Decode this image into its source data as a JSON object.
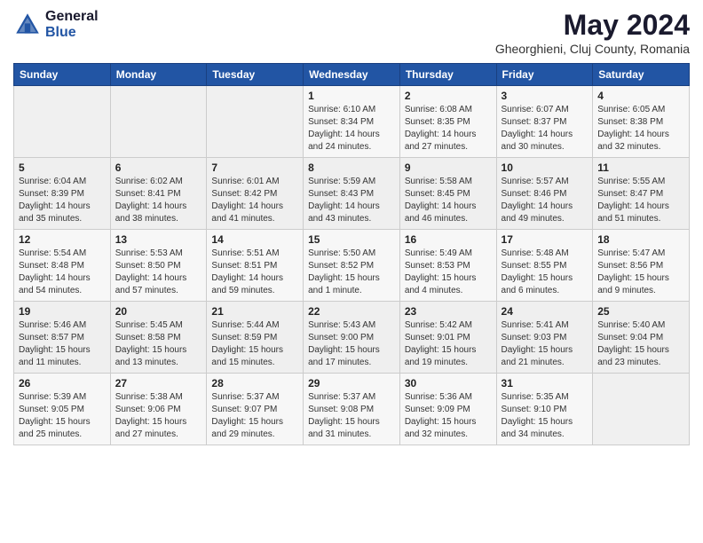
{
  "header": {
    "logo_general": "General",
    "logo_blue": "Blue",
    "month_year": "May 2024",
    "location": "Gheorghieni, Cluj County, Romania"
  },
  "weekdays": [
    "Sunday",
    "Monday",
    "Tuesday",
    "Wednesday",
    "Thursday",
    "Friday",
    "Saturday"
  ],
  "weeks": [
    [
      {
        "day": "",
        "info": ""
      },
      {
        "day": "",
        "info": ""
      },
      {
        "day": "",
        "info": ""
      },
      {
        "day": "1",
        "info": "Sunrise: 6:10 AM\nSunset: 8:34 PM\nDaylight: 14 hours\nand 24 minutes."
      },
      {
        "day": "2",
        "info": "Sunrise: 6:08 AM\nSunset: 8:35 PM\nDaylight: 14 hours\nand 27 minutes."
      },
      {
        "day": "3",
        "info": "Sunrise: 6:07 AM\nSunset: 8:37 PM\nDaylight: 14 hours\nand 30 minutes."
      },
      {
        "day": "4",
        "info": "Sunrise: 6:05 AM\nSunset: 8:38 PM\nDaylight: 14 hours\nand 32 minutes."
      }
    ],
    [
      {
        "day": "5",
        "info": "Sunrise: 6:04 AM\nSunset: 8:39 PM\nDaylight: 14 hours\nand 35 minutes."
      },
      {
        "day": "6",
        "info": "Sunrise: 6:02 AM\nSunset: 8:41 PM\nDaylight: 14 hours\nand 38 minutes."
      },
      {
        "day": "7",
        "info": "Sunrise: 6:01 AM\nSunset: 8:42 PM\nDaylight: 14 hours\nand 41 minutes."
      },
      {
        "day": "8",
        "info": "Sunrise: 5:59 AM\nSunset: 8:43 PM\nDaylight: 14 hours\nand 43 minutes."
      },
      {
        "day": "9",
        "info": "Sunrise: 5:58 AM\nSunset: 8:45 PM\nDaylight: 14 hours\nand 46 minutes."
      },
      {
        "day": "10",
        "info": "Sunrise: 5:57 AM\nSunset: 8:46 PM\nDaylight: 14 hours\nand 49 minutes."
      },
      {
        "day": "11",
        "info": "Sunrise: 5:55 AM\nSunset: 8:47 PM\nDaylight: 14 hours\nand 51 minutes."
      }
    ],
    [
      {
        "day": "12",
        "info": "Sunrise: 5:54 AM\nSunset: 8:48 PM\nDaylight: 14 hours\nand 54 minutes."
      },
      {
        "day": "13",
        "info": "Sunrise: 5:53 AM\nSunset: 8:50 PM\nDaylight: 14 hours\nand 57 minutes."
      },
      {
        "day": "14",
        "info": "Sunrise: 5:51 AM\nSunset: 8:51 PM\nDaylight: 14 hours\nand 59 minutes."
      },
      {
        "day": "15",
        "info": "Sunrise: 5:50 AM\nSunset: 8:52 PM\nDaylight: 15 hours\nand 1 minute."
      },
      {
        "day": "16",
        "info": "Sunrise: 5:49 AM\nSunset: 8:53 PM\nDaylight: 15 hours\nand 4 minutes."
      },
      {
        "day": "17",
        "info": "Sunrise: 5:48 AM\nSunset: 8:55 PM\nDaylight: 15 hours\nand 6 minutes."
      },
      {
        "day": "18",
        "info": "Sunrise: 5:47 AM\nSunset: 8:56 PM\nDaylight: 15 hours\nand 9 minutes."
      }
    ],
    [
      {
        "day": "19",
        "info": "Sunrise: 5:46 AM\nSunset: 8:57 PM\nDaylight: 15 hours\nand 11 minutes."
      },
      {
        "day": "20",
        "info": "Sunrise: 5:45 AM\nSunset: 8:58 PM\nDaylight: 15 hours\nand 13 minutes."
      },
      {
        "day": "21",
        "info": "Sunrise: 5:44 AM\nSunset: 8:59 PM\nDaylight: 15 hours\nand 15 minutes."
      },
      {
        "day": "22",
        "info": "Sunrise: 5:43 AM\nSunset: 9:00 PM\nDaylight: 15 hours\nand 17 minutes."
      },
      {
        "day": "23",
        "info": "Sunrise: 5:42 AM\nSunset: 9:01 PM\nDaylight: 15 hours\nand 19 minutes."
      },
      {
        "day": "24",
        "info": "Sunrise: 5:41 AM\nSunset: 9:03 PM\nDaylight: 15 hours\nand 21 minutes."
      },
      {
        "day": "25",
        "info": "Sunrise: 5:40 AM\nSunset: 9:04 PM\nDaylight: 15 hours\nand 23 minutes."
      }
    ],
    [
      {
        "day": "26",
        "info": "Sunrise: 5:39 AM\nSunset: 9:05 PM\nDaylight: 15 hours\nand 25 minutes."
      },
      {
        "day": "27",
        "info": "Sunrise: 5:38 AM\nSunset: 9:06 PM\nDaylight: 15 hours\nand 27 minutes."
      },
      {
        "day": "28",
        "info": "Sunrise: 5:37 AM\nSunset: 9:07 PM\nDaylight: 15 hours\nand 29 minutes."
      },
      {
        "day": "29",
        "info": "Sunrise: 5:37 AM\nSunset: 9:08 PM\nDaylight: 15 hours\nand 31 minutes."
      },
      {
        "day": "30",
        "info": "Sunrise: 5:36 AM\nSunset: 9:09 PM\nDaylight: 15 hours\nand 32 minutes."
      },
      {
        "day": "31",
        "info": "Sunrise: 5:35 AM\nSunset: 9:10 PM\nDaylight: 15 hours\nand 34 minutes."
      },
      {
        "day": "",
        "info": ""
      }
    ]
  ]
}
